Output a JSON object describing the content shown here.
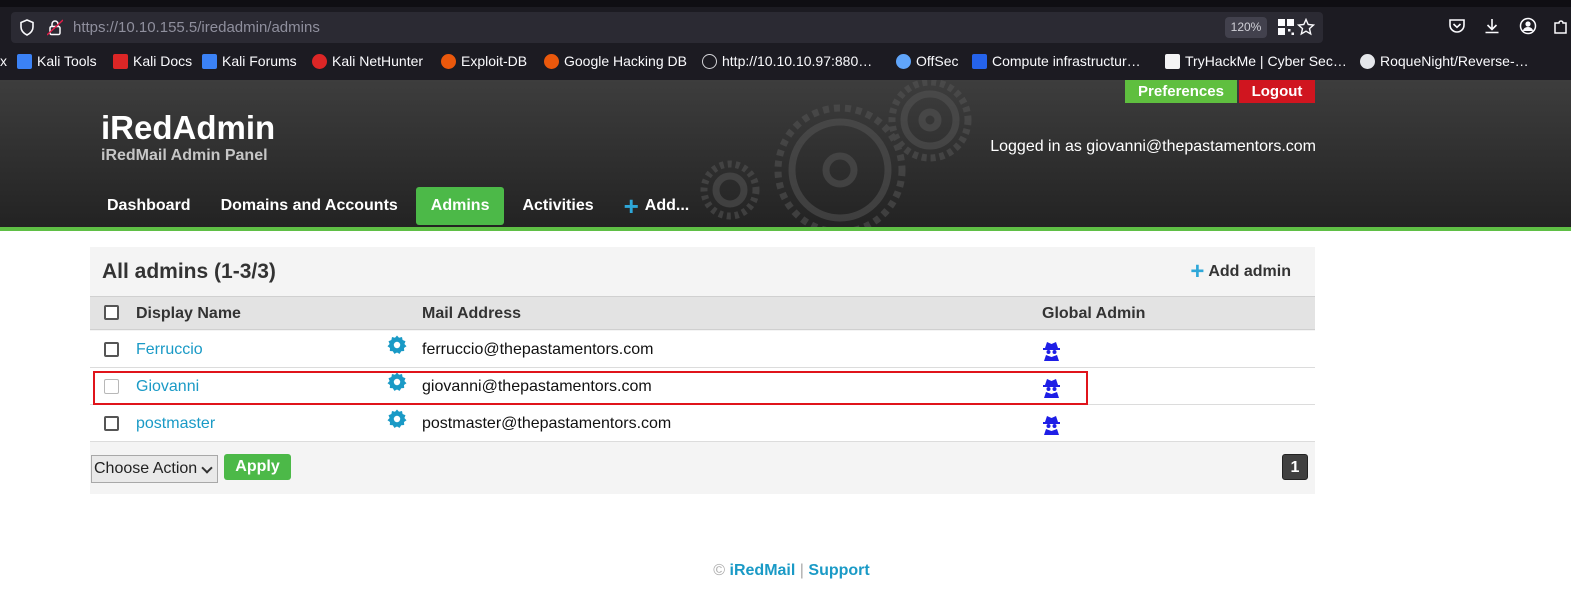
{
  "browser": {
    "url_host": "https://10.10.155.5",
    "url_path": "/iredadmin/admins",
    "zoom": "120%",
    "bookmarks": [
      {
        "label": "Kali Tools",
        "color": "#3b82f6"
      },
      {
        "label": "Kali Docs",
        "color": "#dc2626"
      },
      {
        "label": "Kali Forums",
        "color": "#3b82f6"
      },
      {
        "label": "Kali NetHunter",
        "color": "#dc2626"
      },
      {
        "label": "Exploit-DB",
        "color": "#ea580c"
      },
      {
        "label": "Google Hacking DB",
        "color": "#ea580c"
      },
      {
        "label": "http://10.10.10.97:880…",
        "color": "#d4d4d8"
      },
      {
        "label": "OffSec",
        "color": "#60a5fa"
      },
      {
        "label": "Compute infrastructur…",
        "color": "#2563eb"
      },
      {
        "label": "TryHackMe | Cyber Sec…",
        "color": "#f4f4f5"
      },
      {
        "label": "RoqueNight/Reverse-…",
        "color": "#e5e7eb"
      }
    ],
    "bookmark_lead": "x"
  },
  "header": {
    "title": "iRedAdmin",
    "subtitle": "iRedMail Admin Panel",
    "preferences": "Preferences",
    "logout": "Logout",
    "logged_in": "Logged in as giovanni@thepastamentors.com",
    "nav": {
      "dashboard": "Dashboard",
      "domains": "Domains and Accounts",
      "admins": "Admins",
      "activities": "Activities",
      "add": "Add..."
    }
  },
  "panel": {
    "title": "All admins (1-3/3)",
    "add_admin": "Add admin",
    "columns": {
      "display_name": "Display Name",
      "mail": "Mail Address",
      "global_admin": "Global Admin"
    },
    "rows": [
      {
        "name": "Ferruccio",
        "mail": "ferruccio@thepastamentors.com"
      },
      {
        "name": "Giovanni",
        "mail": "giovanni@thepastamentors.com"
      },
      {
        "name": "postmaster",
        "mail": "postmaster@thepastamentors.com"
      }
    ],
    "action_select": "Choose Action",
    "apply": "Apply",
    "page": "1"
  },
  "footer": {
    "copyright": "©",
    "brand": "iRedMail",
    "separator": "|",
    "support": "Support"
  },
  "colors": {
    "accent_green": "#4cb948",
    "logout_red": "#d0151f",
    "link_blue": "#1a9ac6",
    "highlight_red": "#e0141b"
  }
}
